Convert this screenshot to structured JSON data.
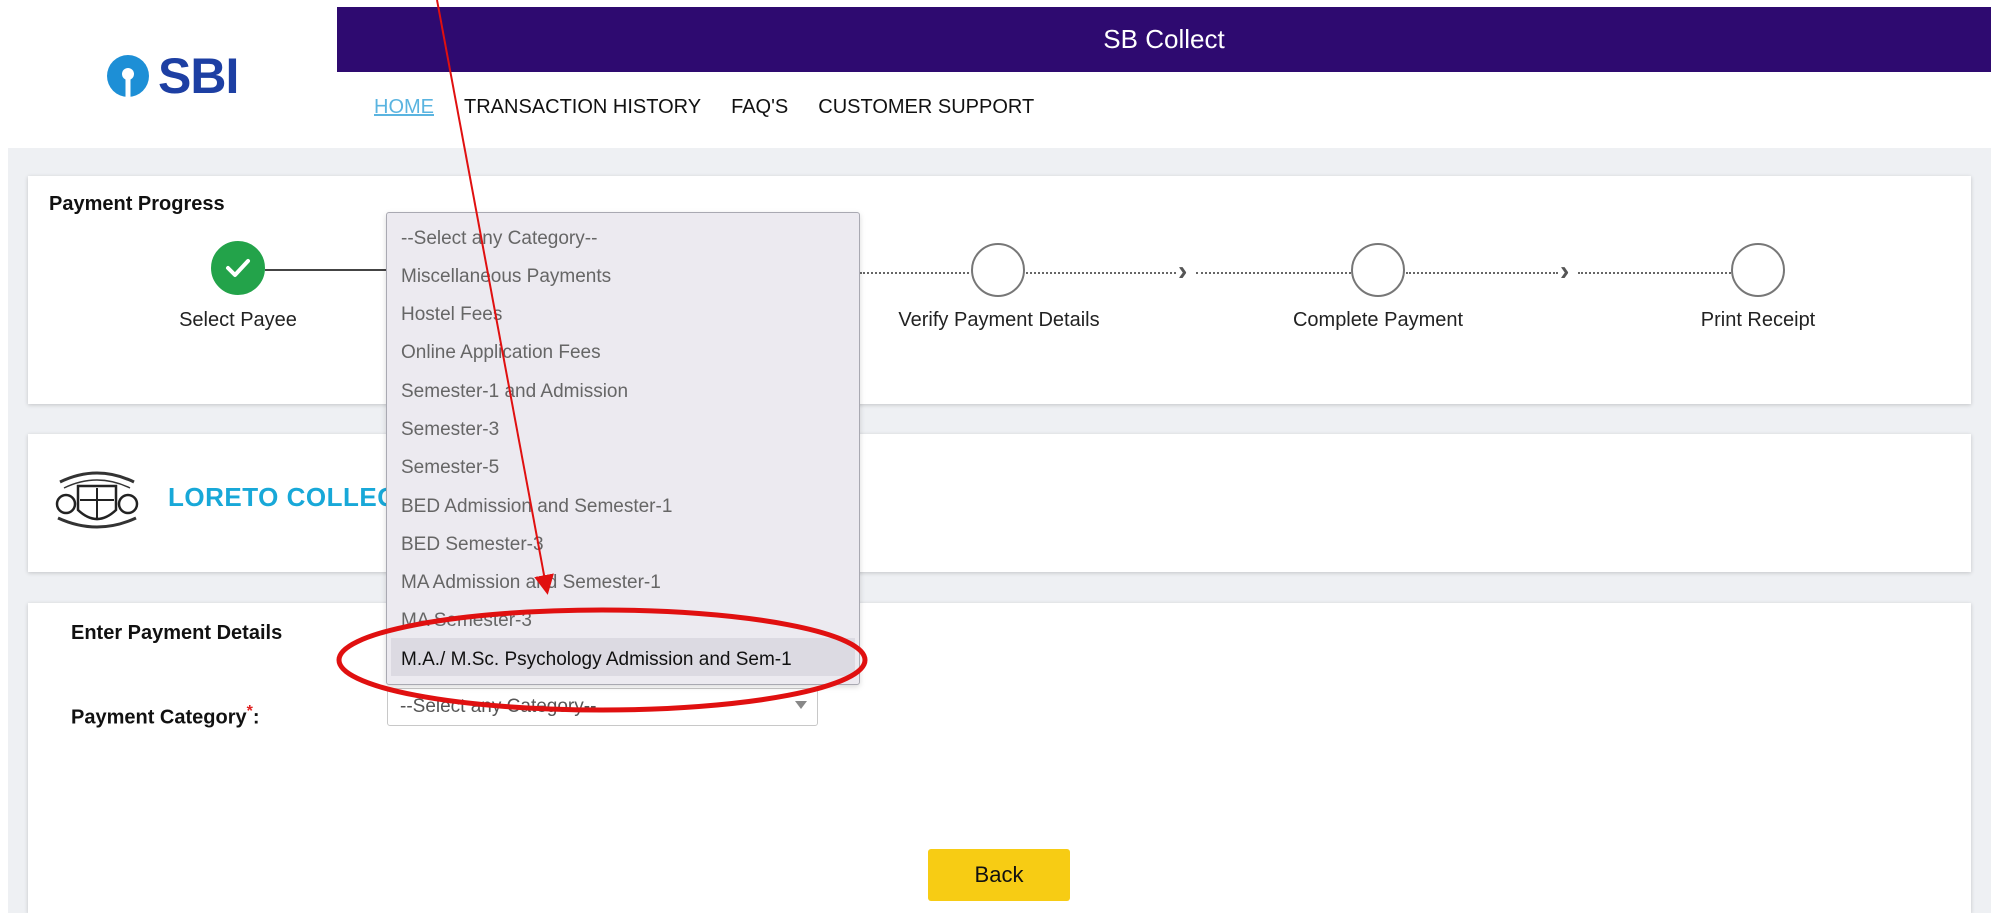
{
  "brand": {
    "logo_text": "SBI",
    "app_title": "SB Collect"
  },
  "nav": {
    "items": [
      "HOME",
      "TRANSACTION HISTORY",
      "FAQ'S",
      "CUSTOMER SUPPORT"
    ]
  },
  "progress": {
    "title": "Payment Progress",
    "steps": [
      "Select Payee",
      "Verify Payment Details",
      "Complete Payment",
      "Print Receipt"
    ]
  },
  "college": {
    "name": "LORETO COLLEG"
  },
  "details": {
    "title": "Enter Payment Details",
    "category_label": "Payment Category",
    "required_mark": "*",
    "colon": ":",
    "select_value": "--Select any Category--"
  },
  "dropdown": {
    "options": [
      "--Select any Category--",
      "Miscellaneous Payments",
      "Hostel Fees",
      "Online Application Fees",
      "Semester-1 and Admission",
      "Semester-3",
      "Semester-5",
      "BED Admission and Semester-1",
      "BED Semester-3",
      "MA Admission and Semester-1",
      "MA Semester-3",
      "M.A./ M.Sc. Psychology Admission and Sem-1"
    ],
    "highlighted_index": 11
  },
  "buttons": {
    "back": "Back"
  },
  "colors": {
    "topbar": "#2e0a70",
    "brand_blue": "#1d3fa3",
    "nav_active": "#5ab4e0",
    "step_done": "#23a34a",
    "college_name": "#18a8d8",
    "back_button": "#f7cc14",
    "annotation": "#e01010"
  }
}
